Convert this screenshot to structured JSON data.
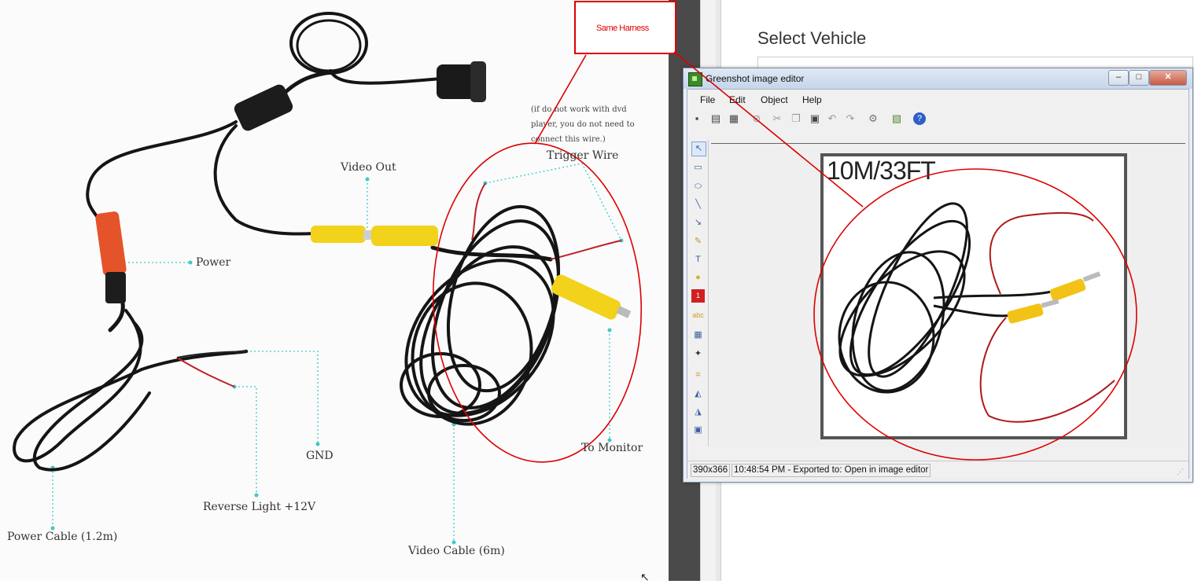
{
  "diagram": {
    "labels": {
      "video_out": "Video Out",
      "power": "Power",
      "trigger_wire": "Trigger Wire",
      "gnd": "GND",
      "reverse_light": "Reverse Light +12V",
      "power_cable": "Power Cable (1.2m)",
      "video_cable": "Video Cable (6m)",
      "to_monitor": "To Monitor"
    },
    "note_lines": [
      "(if do not work with dvd",
      "player, you do not need to",
      "connect this wire.)"
    ]
  },
  "callout": {
    "text": "Same Harness",
    "color": "#dd0000"
  },
  "page": {
    "title": "Select Vehicle"
  },
  "editor": {
    "window_title": "Greenshot image editor",
    "menu": [
      "File",
      "Edit",
      "Object",
      "Help"
    ],
    "image_caption": "10M/33FT",
    "status": {
      "size": "390x366",
      "message": "10:48:54 PM - Exported to: Open in image editor"
    },
    "controls": {
      "minimize": "‒",
      "maximize": "□",
      "close": "✕"
    }
  },
  "toolbar_icons": [
    "save-icon",
    "clipboard-icon",
    "print-icon",
    "delete-icon",
    "cut-icon",
    "copy-icon",
    "paste-icon",
    "undo-icon",
    "redo-icon",
    "settings-icon",
    "export-icon",
    "help-icon"
  ],
  "tool_icons": [
    "pointer-icon",
    "rectangle-icon",
    "ellipse-icon",
    "line-icon",
    "arrow-icon",
    "freehand-icon",
    "text-icon",
    "speechbubble-icon",
    "counter-icon",
    "highlight-icon",
    "obfuscate-icon",
    "effects-icon",
    "crop-icon",
    "rotate-cw-icon",
    "rotate-ccw-icon",
    "resize-icon"
  ],
  "colors": {
    "annotation": "#dd0000",
    "guide": "#40c8c8",
    "cable": "#151515",
    "rca_yellow": "#f2d21a",
    "connector_red": "#e5532a"
  }
}
